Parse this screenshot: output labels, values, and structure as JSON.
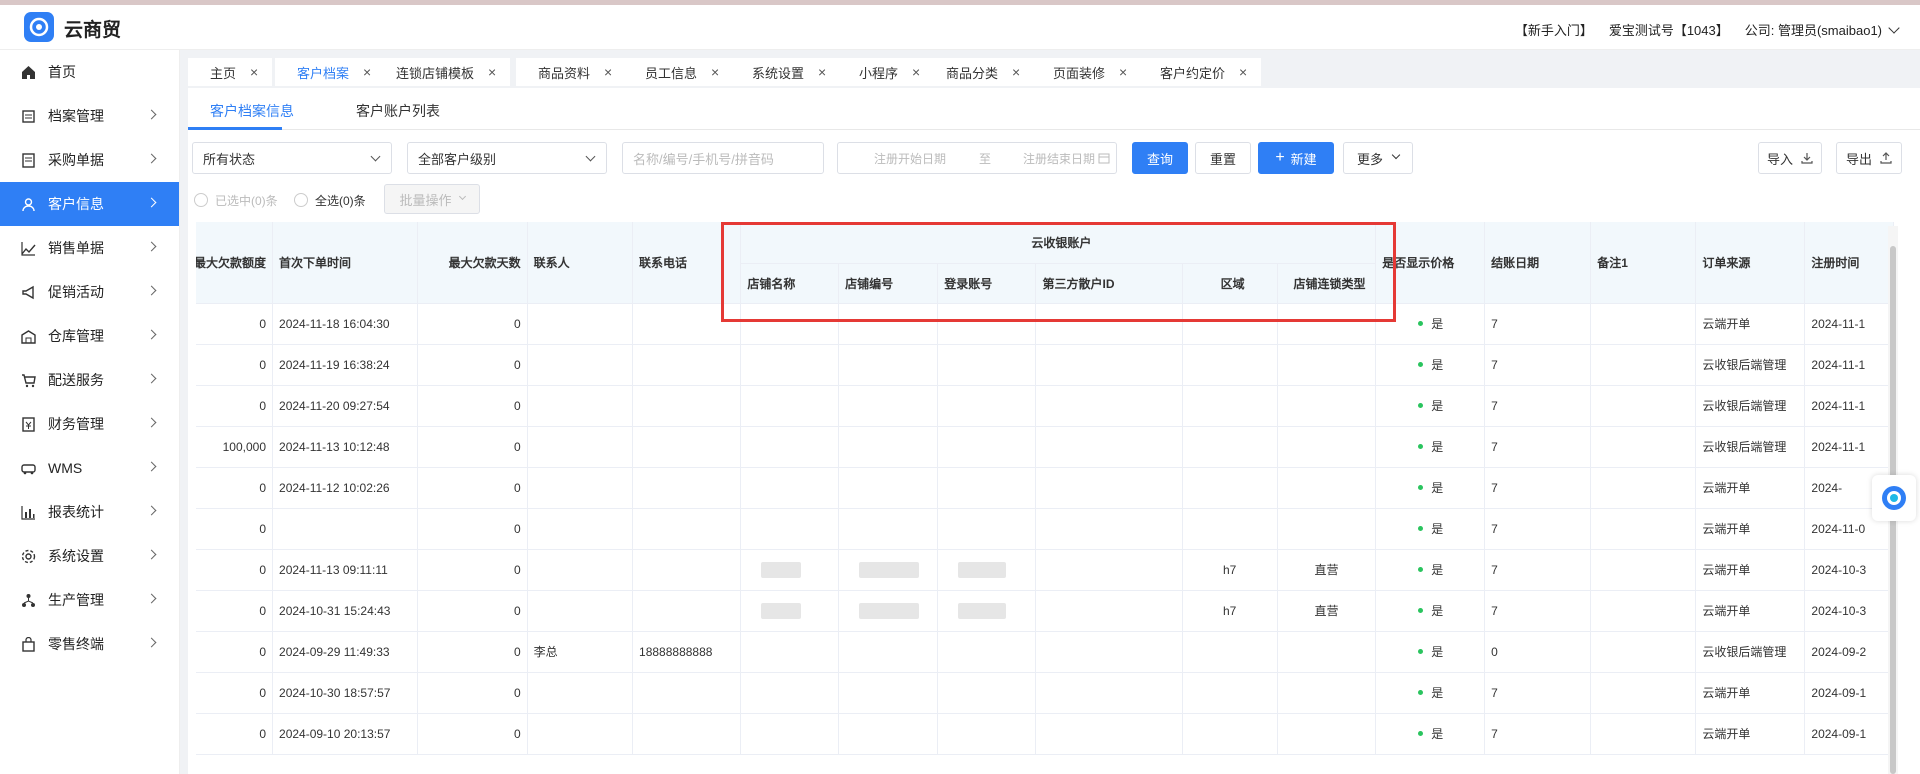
{
  "app": {
    "title": "云商贸"
  },
  "topbar": {
    "newbie": "【新手入门】",
    "account": "爱宝测试号【1043】",
    "company": "公司: 管理员(smaibao1)"
  },
  "sidebar": {
    "items": [
      {
        "label": "首页",
        "icon": "home-icon"
      },
      {
        "label": "档案管理",
        "icon": "archive-icon"
      },
      {
        "label": "采购单据",
        "icon": "purchase-icon"
      },
      {
        "label": "客户信息",
        "icon": "user-icon",
        "active": true
      },
      {
        "label": "销售单据",
        "icon": "sales-chart-icon"
      },
      {
        "label": "促销活动",
        "icon": "megaphone-icon"
      },
      {
        "label": "仓库管理",
        "icon": "warehouse-icon"
      },
      {
        "label": "配送服务",
        "icon": "cart-icon"
      },
      {
        "label": "财务管理",
        "icon": "finance-icon"
      },
      {
        "label": "WMS",
        "icon": "truck-icon"
      },
      {
        "label": "报表统计",
        "icon": "bar-chart-icon"
      },
      {
        "label": "系统设置",
        "icon": "gear-icon"
      },
      {
        "label": "生产管理",
        "icon": "network-icon"
      },
      {
        "label": "零售终端",
        "icon": "bag-icon"
      }
    ]
  },
  "tabs": [
    {
      "label": "主页"
    },
    {
      "label": "客户档案",
      "active": true
    },
    {
      "label": "连锁店铺模板"
    },
    {
      "label": "商品资料"
    },
    {
      "label": "员工信息"
    },
    {
      "label": "系统设置"
    },
    {
      "label": "小程序"
    },
    {
      "label": "商品分类"
    },
    {
      "label": "页面装修"
    },
    {
      "label": "客户约定价"
    }
  ],
  "subtabs": {
    "info": "客户档案信息",
    "accounts": "客户账户列表"
  },
  "filters": {
    "status": "所有状态",
    "level": "全部客户级别",
    "search_placeholder": "名称/编号/手机号/拼音码",
    "date_start": "注册开始日期",
    "date_sep": "至",
    "date_end": "注册结束日期",
    "query": "查询",
    "reset": "重置",
    "new": "新建",
    "more": "更多",
    "import": "导入",
    "export": "导出"
  },
  "batch": {
    "selected": "已选中(0)条",
    "select_all": "全选(0)条",
    "batch_op": "批量操作"
  },
  "table": {
    "headers": {
      "max_credit": "最大欠款额度",
      "first_order": "首次下单时间",
      "max_days": "最大欠款天数",
      "contact": "联系人",
      "phone": "联系电话",
      "group": "云收银账户",
      "store_name": "店铺名称",
      "store_no": "店铺编号",
      "login": "登录账号",
      "third_id": "第三方散户ID",
      "region": "区域",
      "chain_type": "店铺连锁类型",
      "show_price": "是否显示价格",
      "settle_date": "结账日期",
      "remark": "备注1",
      "source": "订单来源",
      "reg_time": "注册时间"
    },
    "rows": [
      {
        "credit": "0",
        "first": "2024-11-18 16:04:30",
        "days": "0",
        "contact": "",
        "phone": "",
        "blurred": false,
        "region": "",
        "chain": "",
        "show": "是",
        "settle": "7",
        "remark": "",
        "source": "云端开单",
        "reg": "2024-11-1"
      },
      {
        "credit": "0",
        "first": "2024-11-19 16:38:24",
        "days": "0",
        "contact": "",
        "phone": "",
        "blurred": false,
        "region": "",
        "chain": "",
        "show": "是",
        "settle": "7",
        "remark": "",
        "source": "云收银后端管理",
        "reg": "2024-11-1"
      },
      {
        "credit": "0",
        "first": "2024-11-20 09:27:54",
        "days": "0",
        "contact": "",
        "phone": "",
        "blurred": false,
        "region": "",
        "chain": "",
        "show": "是",
        "settle": "7",
        "remark": "",
        "source": "云收银后端管理",
        "reg": "2024-11-1"
      },
      {
        "credit": "100,000",
        "first": "2024-11-13 10:12:48",
        "days": "0",
        "contact": "",
        "phone": "",
        "blurred": false,
        "region": "",
        "chain": "",
        "show": "是",
        "settle": "7",
        "remark": "",
        "source": "云收银后端管理",
        "reg": "2024-11-1"
      },
      {
        "credit": "0",
        "first": "2024-11-12 10:02:26",
        "days": "0",
        "contact": "",
        "phone": "",
        "blurred": false,
        "region": "",
        "chain": "",
        "show": "是",
        "settle": "7",
        "remark": "",
        "source": "云端开单",
        "reg": "2024-"
      },
      {
        "credit": "0",
        "first": "",
        "days": "0",
        "contact": "",
        "phone": "",
        "blurred": false,
        "region": "",
        "chain": "",
        "show": "是",
        "settle": "7",
        "remark": "",
        "source": "云端开单",
        "reg": "2024-11-0"
      },
      {
        "credit": "0",
        "first": "2024-11-13 09:11:11",
        "days": "0",
        "contact": "",
        "phone": "",
        "blurred": true,
        "region": "h7",
        "chain": "直营",
        "show": "是",
        "settle": "7",
        "remark": "",
        "source": "云端开单",
        "reg": "2024-10-3"
      },
      {
        "credit": "0",
        "first": "2024-10-31 15:24:43",
        "days": "0",
        "contact": "",
        "phone": "",
        "blurred": true,
        "region": "h7",
        "chain": "直营",
        "show": "是",
        "settle": "7",
        "remark": "",
        "source": "云端开单",
        "reg": "2024-10-3"
      },
      {
        "credit": "0",
        "first": "2024-09-29 11:49:33",
        "days": "0",
        "contact": "李总",
        "phone": "18888888888",
        "blurred": false,
        "region": "",
        "chain": "",
        "show": "是",
        "settle": "0",
        "remark": "",
        "source": "云收银后端管理",
        "reg": "2024-09-2"
      },
      {
        "credit": "0",
        "first": "2024-10-30 18:57:57",
        "days": "0",
        "contact": "",
        "phone": "",
        "blurred": false,
        "region": "",
        "chain": "",
        "show": "是",
        "settle": "7",
        "remark": "",
        "source": "云端开单",
        "reg": "2024-09-1"
      },
      {
        "credit": "0",
        "first": "2024-09-10 20:13:57",
        "days": "0",
        "contact": "",
        "phone": "",
        "blurred": false,
        "region": "",
        "chain": "",
        "show": "是",
        "settle": "7",
        "remark": "",
        "source": "云端开单",
        "reg": "2024-09-1"
      }
    ]
  },
  "colors": {
    "accent": "#2f7ff5",
    "highlight": "#e53935",
    "ok": "#2ac45e"
  }
}
